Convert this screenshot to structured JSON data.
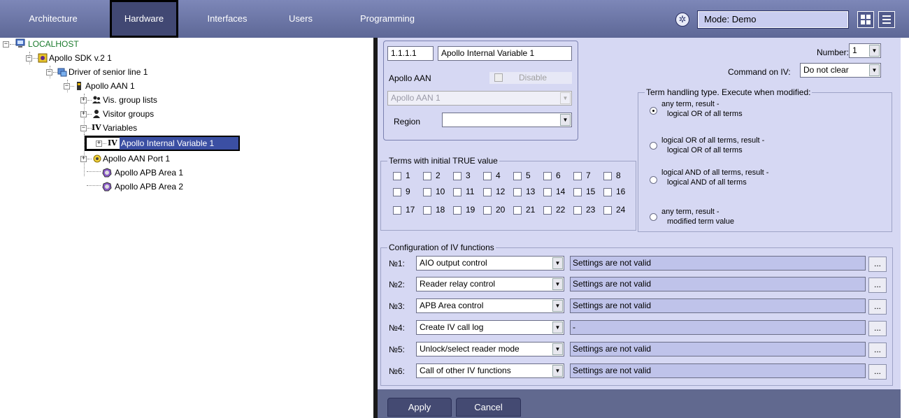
{
  "tabs": [
    {
      "label": "Architecture"
    },
    {
      "label": "Hardware"
    },
    {
      "label": "Interfaces"
    },
    {
      "label": "Users"
    },
    {
      "label": "Programming"
    }
  ],
  "mode": {
    "label": "Mode: Demo"
  },
  "tree": {
    "localhost": "LOCALHOST",
    "sdk": "Apollo SDK v.2 1",
    "driver": "Driver of senior line 1",
    "aan": "Apollo AAN 1",
    "vis_group_lists": "Vis. group lists",
    "visitor_groups": "Visitor groups",
    "variables": "Variables",
    "internal_variable": "Apollo Internal Variable 1",
    "aan_port": "Apollo AAN Port 1",
    "apb_area_1": "Apollo APB Area 1",
    "apb_area_2": "Apollo APB Area 2"
  },
  "form": {
    "id_value": "1.1.1.1",
    "name_value": "Apollo Internal Variable 1",
    "aan_label": "Apollo AAN",
    "disable_label": "Disable",
    "aan_select": "Apollo AAN 1",
    "region_label": "Region",
    "region_value": "",
    "number_label": "Number:",
    "number_value": "1",
    "command_label": "Command on IV:",
    "command_value": "Do not clear"
  },
  "term_handling": {
    "title": "Term handling type. Execute when modified:",
    "options": [
      {
        "line1": "any term, result -",
        "line2": "logical OR of all terms",
        "selected": true
      },
      {
        "line1": "logical OR of all terms, result -",
        "line2": "logical OR of all terms",
        "selected": false
      },
      {
        "line1": "logical AND of all terms, result -",
        "line2": "logical AND of all terms",
        "selected": false
      },
      {
        "line1": "any term, result -",
        "line2": "modified term value",
        "selected": false
      }
    ]
  },
  "terms": {
    "title": "Terms with initial TRUE value",
    "numbers": [
      "1",
      "2",
      "3",
      "4",
      "5",
      "6",
      "7",
      "8",
      "9",
      "10",
      "11",
      "12",
      "13",
      "14",
      "15",
      "16",
      "17",
      "18",
      "19",
      "20",
      "21",
      "22",
      "23",
      "24"
    ]
  },
  "iv_functions": {
    "title": "Configuration of IV functions",
    "rows": [
      {
        "label": "№1:",
        "function": "AIO output control",
        "status": "Settings are not valid"
      },
      {
        "label": "№2:",
        "function": "Reader relay control",
        "status": "Settings are not valid"
      },
      {
        "label": "№3:",
        "function": "APB Area control",
        "status": "Settings are not valid"
      },
      {
        "label": "№4:",
        "function": "Create IV call log",
        "status": "-"
      },
      {
        "label": "№5:",
        "function": "Unlock/select reader mode",
        "status": "Settings are not valid"
      },
      {
        "label": "№6:",
        "function": "Call of other IV functions",
        "status": "Settings are not valid"
      }
    ],
    "ellipsis": "..."
  },
  "buttons": {
    "apply": "Apply",
    "cancel": "Cancel"
  },
  "colors": {
    "topbar": "#6b75a8",
    "active_tab": "#414873",
    "panel": "#d6d8f3",
    "status_field": "#bfc3ea",
    "tree_root": "#1a7a2c",
    "tree_selected": "#3b4fa3"
  },
  "icons": [
    "gear-icon",
    "layout-icon",
    "menu-icon",
    "computer-icon",
    "sdk-icon",
    "driver-icon",
    "controller-icon",
    "group-list-icon",
    "visitor-icon",
    "iv-icon",
    "port-icon",
    "area-icon"
  ]
}
